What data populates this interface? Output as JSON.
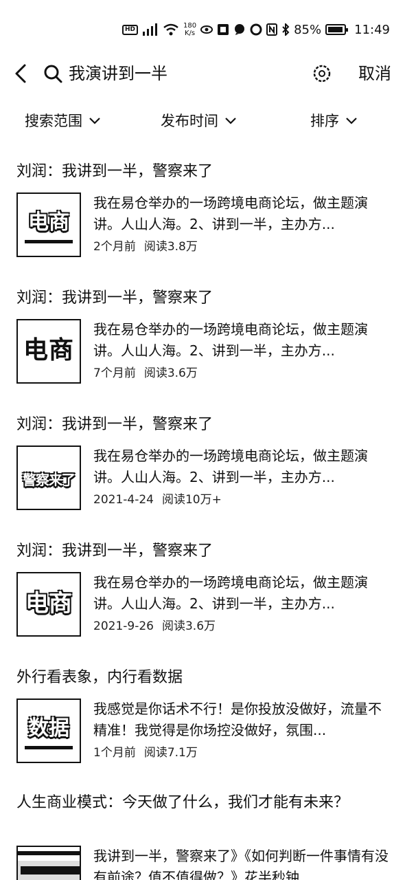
{
  "status_bar": {
    "speed_value": "180",
    "speed_unit": "K/s",
    "battery": "85%",
    "time": "11:49"
  },
  "search": {
    "query": "我演讲到一半",
    "cancel_label": "取消"
  },
  "filters": [
    {
      "label": "搜索范围"
    },
    {
      "label": "发布时间"
    },
    {
      "label": "排序"
    }
  ],
  "results": [
    {
      "title": "刘润：我讲到一半，警察来了",
      "thumb_text": "电商",
      "snippet": "我在易仓举办的一场跨境电商论坛，做主题演讲。人山人海。2、讲到一半，主办方...",
      "time": "2个月前",
      "reads": "阅读3.8万"
    },
    {
      "title": "刘润：我讲到一半，警察来了",
      "thumb_text": "电商",
      "snippet": "我在易仓举办的一场跨境电商论坛，做主题演讲。人山人海。2、讲到一半，主办方...",
      "time": "7个月前",
      "reads": "阅读3.6万"
    },
    {
      "title": "刘润：我讲到一半，警察来了",
      "thumb_text": "警察来了",
      "snippet": "我在易仓举办的一场跨境电商论坛，做主题演讲。人山人海。2、讲到一半，主办方...",
      "time": "2021-4-24",
      "reads": "阅读10万+"
    },
    {
      "title": "刘润：我讲到一半，警察来了",
      "thumb_text": "电商",
      "snippet": "我在易仓举办的一场跨境电商论坛，做主题演讲。人山人海。2、讲到一半，主办方...",
      "time": "2021-9-26",
      "reads": "阅读3.6万"
    },
    {
      "title": "外行看表象，内行看数据",
      "thumb_text": "数据",
      "snippet": "我感觉是你话术不行！是你投放没做好，流量不精准！我觉得是你场控没做好，氛围...",
      "time": "1个月前",
      "reads": "阅读7.1万"
    },
    {
      "title": "人生商业模式：今天做了什么，我们才能有未来？",
      "snippet": "我讲到一半，警察来了》《如何判断一件事情有没有前途？值不值得做？》花半秒钟..."
    }
  ]
}
